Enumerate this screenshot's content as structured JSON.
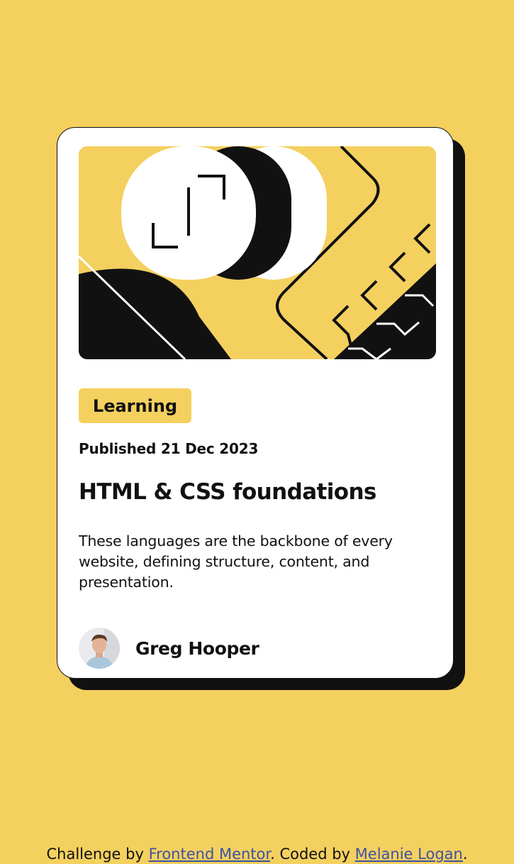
{
  "card": {
    "tag": "Learning",
    "published": "Published 21 Dec 2023",
    "title": "HTML & CSS foundations",
    "description": "These languages are the backbone of every website, defining structure, content, and presentation.",
    "author": {
      "name": "Greg Hooper"
    }
  },
  "footer": {
    "prefix": "Challenge by ",
    "link1": "Frontend Mentor",
    "middle": ". Coded by ",
    "link2": "Melanie Logan",
    "suffix": "."
  },
  "colors": {
    "background": "#f4d05f",
    "card": "#ffffff",
    "text": "#111111",
    "link": "#3e52a3"
  },
  "icons": {
    "hero": "abstract-illustration-image",
    "avatar": "greg-hooper-avatar"
  }
}
